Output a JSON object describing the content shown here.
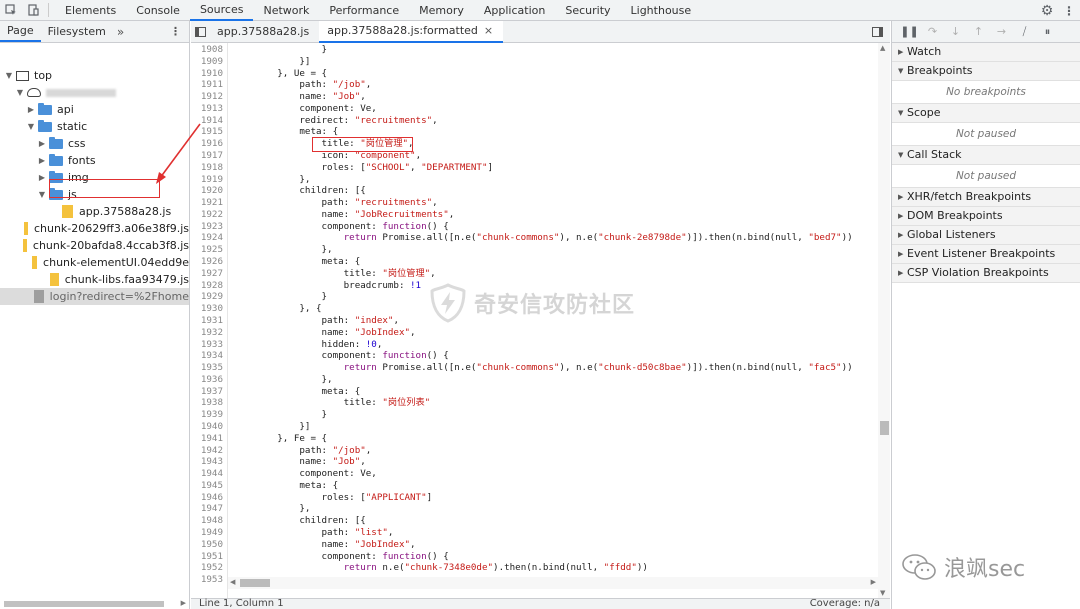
{
  "top_tabs": [
    "Elements",
    "Console",
    "Sources",
    "Network",
    "Performance",
    "Memory",
    "Application",
    "Security",
    "Lighthouse"
  ],
  "active_top_tab": "Sources",
  "navigator": {
    "tabs": [
      "Page",
      "Filesystem"
    ],
    "more": "»",
    "tree": [
      {
        "label": "top",
        "kind": "frame",
        "depth": 0,
        "open": true
      },
      {
        "label": "",
        "kind": "cloud",
        "depth": 1,
        "open": true
      },
      {
        "label": "api",
        "kind": "folder",
        "depth": 2,
        "open": false
      },
      {
        "label": "static",
        "kind": "folder",
        "depth": 2,
        "open": true
      },
      {
        "label": "css",
        "kind": "folder",
        "depth": 3,
        "open": false
      },
      {
        "label": "fonts",
        "kind": "folder",
        "depth": 3,
        "open": false
      },
      {
        "label": "img",
        "kind": "folder",
        "depth": 3,
        "open": false
      },
      {
        "label": "js",
        "kind": "folder",
        "depth": 3,
        "open": true
      },
      {
        "label": "app.37588a28.js",
        "kind": "file",
        "depth": 4
      },
      {
        "label": "chunk-20629ff3.a06e38f9.js",
        "kind": "file",
        "depth": 4
      },
      {
        "label": "chunk-20bafda8.4ccab3f8.js",
        "kind": "file",
        "depth": 4
      },
      {
        "label": "chunk-elementUI.04edd9e",
        "kind": "file",
        "depth": 4
      },
      {
        "label": "chunk-libs.faa93479.js",
        "kind": "file",
        "depth": 4
      },
      {
        "label": "login?redirect=%2Fhome",
        "kind": "doc",
        "depth": 2,
        "selected": true
      }
    ]
  },
  "editor": {
    "tabs": [
      {
        "label": "app.37588a28.js",
        "active": false
      },
      {
        "label": "app.37588a28.js:formatted",
        "active": true,
        "close": "×"
      }
    ],
    "lines": [
      {
        "n": "1908",
        "t": "                }"
      },
      {
        "n": "1909",
        "t": "            }]"
      },
      {
        "n": "1910",
        "t": "        }, Ue = {"
      },
      {
        "n": "1911",
        "t": "            path: \"/job\","
      },
      {
        "n": "1912",
        "t": "            name: \"Job\","
      },
      {
        "n": "1913",
        "t": "            component: Ve,"
      },
      {
        "n": "1914",
        "t": "            redirect: \"recruitments\","
      },
      {
        "n": "1915",
        "t": "            meta: {"
      },
      {
        "n": "1916",
        "t": "                title: \"岗位管理\","
      },
      {
        "n": "1917",
        "t": "                icon: \"component\","
      },
      {
        "n": "1918",
        "t": "                roles: [\"SCHOOL\", \"DEPARTMENT\"]"
      },
      {
        "n": "1919",
        "t": "            },"
      },
      {
        "n": "1920",
        "t": "            children: [{"
      },
      {
        "n": "1921",
        "t": "                path: \"recruitments\","
      },
      {
        "n": "1922",
        "t": "                name: \"JobRecruitments\","
      },
      {
        "n": "1923",
        "t": "                component: function() {"
      },
      {
        "n": "1924",
        "t": "                    return Promise.all([n.e(\"chunk-commons\"), n.e(\"chunk-2e8798de\")]).then(n.bind(null, \"bed7\"))"
      },
      {
        "n": "1925",
        "t": "                },"
      },
      {
        "n": "1926",
        "t": "                meta: {"
      },
      {
        "n": "1927",
        "t": "                    title: \"岗位管理\","
      },
      {
        "n": "1928",
        "t": "                    breadcrumb: !1"
      },
      {
        "n": "1929",
        "t": "                }"
      },
      {
        "n": "1930",
        "t": "            }, {"
      },
      {
        "n": "1931",
        "t": "                path: \"index\","
      },
      {
        "n": "1932",
        "t": "                name: \"JobIndex\","
      },
      {
        "n": "1933",
        "t": "                hidden: !0,"
      },
      {
        "n": "1934",
        "t": "                component: function() {"
      },
      {
        "n": "1935",
        "t": "                    return Promise.all([n.e(\"chunk-commons\"), n.e(\"chunk-d50c8bae\")]).then(n.bind(null, \"fac5\"))"
      },
      {
        "n": "1936",
        "t": "                },"
      },
      {
        "n": "1937",
        "t": "                meta: {"
      },
      {
        "n": "1938",
        "t": "                    title: \"岗位列表\""
      },
      {
        "n": "1939",
        "t": "                }"
      },
      {
        "n": "1940",
        "t": "            }]"
      },
      {
        "n": "1941",
        "t": "        }, Fe = {"
      },
      {
        "n": "1942",
        "t": "            path: \"/job\","
      },
      {
        "n": "1943",
        "t": "            name: \"Job\","
      },
      {
        "n": "1944",
        "t": "            component: Ve,"
      },
      {
        "n": "1945",
        "t": "            meta: {"
      },
      {
        "n": "1946",
        "t": "                roles: [\"APPLICANT\"]"
      },
      {
        "n": "1947",
        "t": "            },"
      },
      {
        "n": "1948",
        "t": "            children: [{"
      },
      {
        "n": "1949",
        "t": "                path: \"list\","
      },
      {
        "n": "1950",
        "t": "                name: \"JobIndex\","
      },
      {
        "n": "1951",
        "t": "                component: function() {"
      },
      {
        "n": "1952",
        "t": "                    return n.e(\"chunk-7348e0de\").then(n.bind(null, \"ffdd\"))"
      },
      {
        "n": "1953",
        "t": ""
      }
    ],
    "status_position": "Line 1, Column 1",
    "status_coverage": "Coverage: n/a"
  },
  "watermark_text": "奇安信攻防社区",
  "debugger": {
    "sections": [
      {
        "title": "Watch",
        "open": false
      },
      {
        "title": "Breakpoints",
        "open": true,
        "body": "No breakpoints"
      },
      {
        "title": "Scope",
        "open": true,
        "body": "Not paused"
      },
      {
        "title": "Call Stack",
        "open": true,
        "body": "Not paused"
      },
      {
        "title": "XHR/fetch Breakpoints",
        "open": false
      },
      {
        "title": "DOM Breakpoints",
        "open": false
      },
      {
        "title": "Global Listeners",
        "open": false
      },
      {
        "title": "Event Listener Breakpoints",
        "open": false
      },
      {
        "title": "CSP Violation Breakpoints",
        "open": false
      }
    ],
    "footer_watermark": "浪飒sec"
  },
  "colors": {
    "accent": "#1a73e8",
    "highlight": "#e03030",
    "string": "#c41a16",
    "keyword": "#881280"
  }
}
